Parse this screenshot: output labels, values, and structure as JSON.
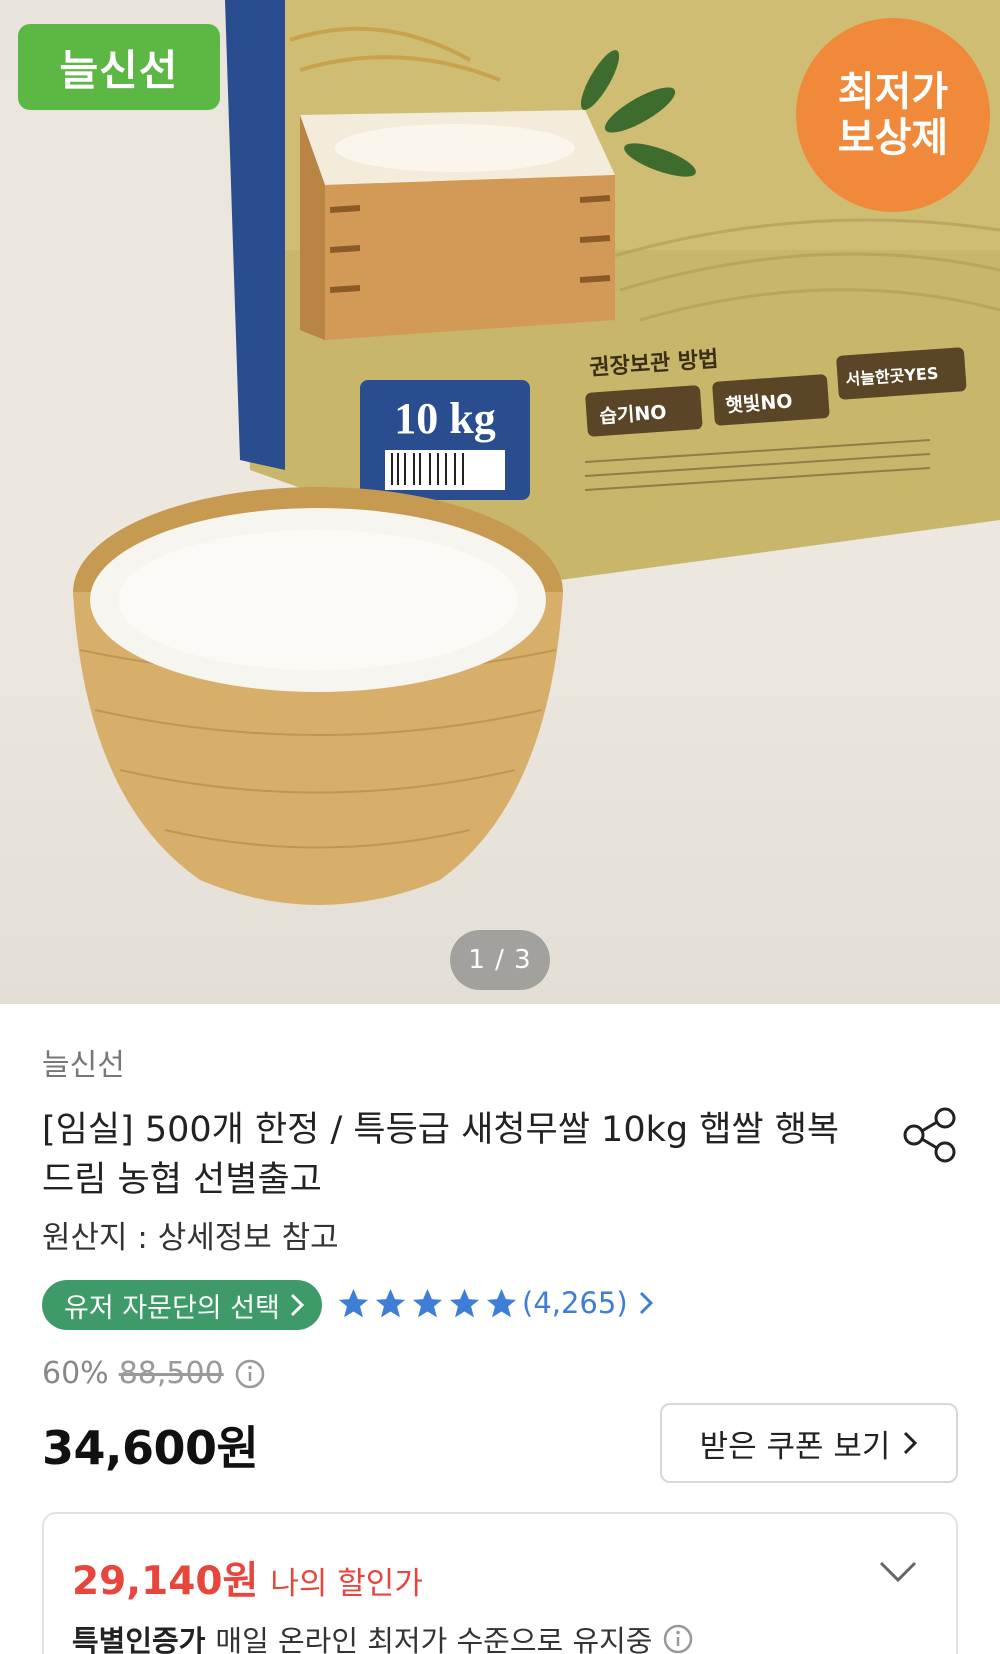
{
  "hero": {
    "brand_badge": "늘신선",
    "price_guarantee_line1": "최저가",
    "price_guarantee_line2": "보상제",
    "bag_weight": "10 kg",
    "bag_storage_title": "권장보관 방법",
    "bag_tag1": "습기NO",
    "bag_tag2": "햇빛NO",
    "bag_tag3": "서늘한곳YES",
    "image_counter": "1 / 3"
  },
  "product": {
    "seller": "늘신선",
    "title": "[임실] 500개 한정 / 특등급 새청무쌀 10kg 햅쌀 행복드림 농협 선별출고",
    "origin": "원산지 : 상세정보 참고",
    "choice_badge": "유저 자문단의 선택",
    "rating_stars": 5,
    "review_count": "(4,265)",
    "discount_rate": "60%",
    "original_price": "88,500",
    "price": "34,600원",
    "coupon_button": "받은 쿠폰 보기",
    "my_price": "29,140원",
    "my_price_label": "나의 할인가",
    "special_label": "특별인증가",
    "special_text": "매일 온라인 최저가 수준으로 유지중"
  },
  "colors": {
    "brand_green": "#5cb744",
    "choice_green": "#3f9a69",
    "star_blue": "#3f7ed6",
    "guarantee_orange": "#f08a3a",
    "discount_red": "#e8453c"
  }
}
